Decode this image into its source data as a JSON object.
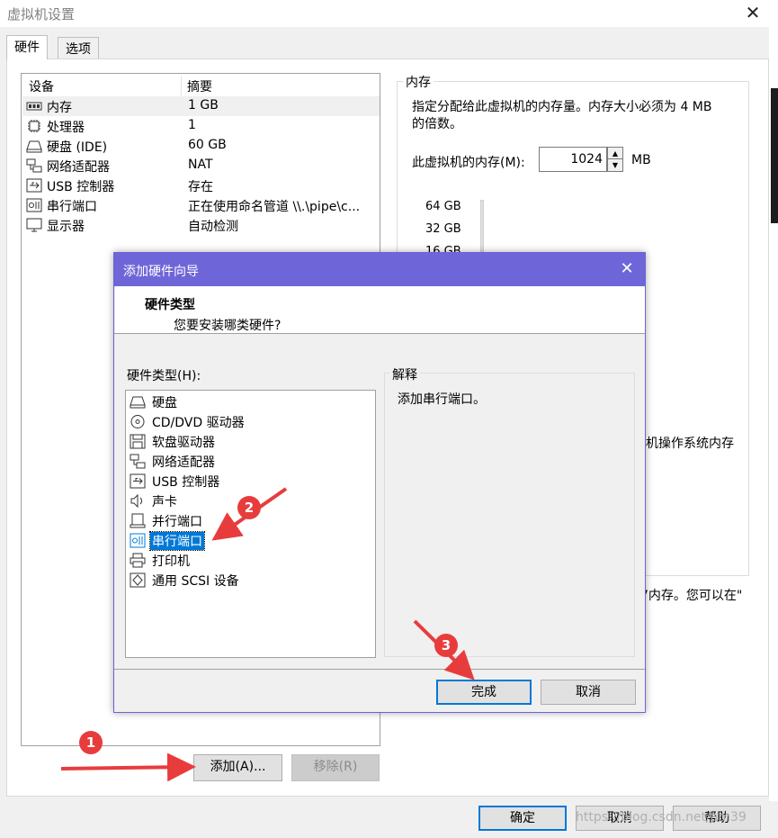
{
  "window": {
    "title": "虚拟机设置"
  },
  "tabs": [
    {
      "label": "硬件"
    },
    {
      "label": "选项"
    }
  ],
  "device_list": {
    "col_device": "设备",
    "col_summary": "摘要",
    "rows": [
      {
        "name": "内存",
        "summary": "1 GB",
        "icon": "memory-icon"
      },
      {
        "name": "处理器",
        "summary": "1",
        "icon": "cpu-icon"
      },
      {
        "name": "硬盘 (IDE)",
        "summary": "60 GB",
        "icon": "hard-disk-icon"
      },
      {
        "name": "网络适配器",
        "summary": "NAT",
        "icon": "network-icon"
      },
      {
        "name": "USB 控制器",
        "summary": "存在",
        "icon": "usb-icon"
      },
      {
        "name": "串行端口",
        "summary": "正在使用命名管道 \\\\.\\pipe\\c...",
        "icon": "serial-port-icon"
      },
      {
        "name": "显示器",
        "summary": "自动检测",
        "icon": "monitor-icon"
      }
    ]
  },
  "memory": {
    "legend": "内存",
    "desc_line1": "指定分配给此虚拟机的内存量。内存大小必须为 4 MB",
    "desc_line2": "的倍数。",
    "field_label": "此虚拟机的内存(M):",
    "value": "1024",
    "unit": "MB",
    "scale": [
      "64 GB",
      "32 GB",
      "16 GB"
    ],
    "partial_text1": "机操作系统内存",
    "partial_text2": "7内存。您可以在\""
  },
  "buttons": {
    "add": "添加(A)...",
    "remove": "移除(R)",
    "ok": "确定",
    "cancel": "取消",
    "help": "帮助"
  },
  "wizard": {
    "title": "添加硬件向导",
    "heading": "硬件类型",
    "subheading": "您要安装哪类硬件?",
    "list_label": "硬件类型(H):",
    "items": [
      {
        "label": "硬盘",
        "icon": "hard-disk-icon"
      },
      {
        "label": "CD/DVD 驱动器",
        "icon": "cd-dvd-icon"
      },
      {
        "label": "软盘驱动器",
        "icon": "floppy-icon"
      },
      {
        "label": "网络适配器",
        "icon": "network-icon"
      },
      {
        "label": "USB 控制器",
        "icon": "usb-icon"
      },
      {
        "label": "声卡",
        "icon": "sound-icon"
      },
      {
        "label": "并行端口",
        "icon": "parallel-port-icon"
      },
      {
        "label": "串行端口",
        "icon": "serial-port-icon"
      },
      {
        "label": "打印机",
        "icon": "printer-icon"
      },
      {
        "label": "通用 SCSI 设备",
        "icon": "scsi-icon"
      }
    ],
    "selected_index": 7,
    "explain_legend": "解释",
    "explain_text": "添加串行端口。",
    "finish": "完成",
    "cancel": "取消"
  },
  "annotations": {
    "badge1": "1",
    "badge2": "2",
    "badge3": "3",
    "color": "#e83c3c"
  },
  "watermark": "https://blog.csdn.net/am39"
}
